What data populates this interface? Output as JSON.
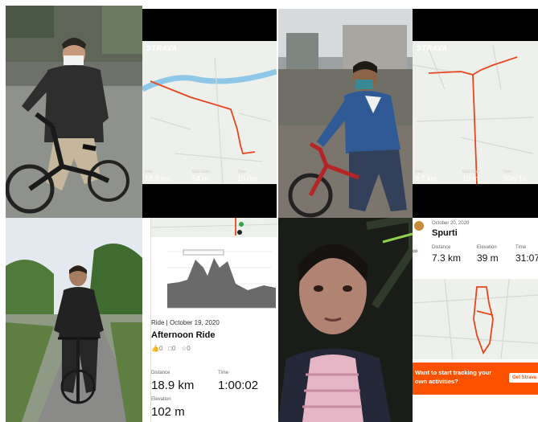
{
  "strava_card_1": {
    "logo": "STRAVA",
    "stats": [
      {
        "label": "Ride",
        "value": "18.8 km"
      },
      {
        "label": "Elev Gain",
        "value": "54 m"
      },
      {
        "label": "Time",
        "value": "1h 0m"
      }
    ]
  },
  "strava_card_2": {
    "logo": "STRAVA",
    "stats": [
      {
        "label": "Ride",
        "value": "9.7 km"
      },
      {
        "label": "Elev Gain",
        "value": "10 m"
      },
      {
        "label": "Time",
        "value": "30m 1s"
      }
    ]
  },
  "activity_card": {
    "ride_line": "Ride | October 19, 2020",
    "title": "Afternoon Ride",
    "kudos": "0",
    "comments": "0",
    "achievements": "0",
    "distance_label": "Distance",
    "distance_value": "18.9 km",
    "time_label": "Time",
    "time_value": "1:00:02",
    "elevation_label": "Elevation",
    "elevation_value": "102 m"
  },
  "spurti_card": {
    "date": "October 20, 2020",
    "name": "Spurti",
    "distance_label": "Distance",
    "distance_value": "7.3 km",
    "elevation_label": "Elevation",
    "elevation_value": "39 m",
    "time_label": "Time",
    "time_value": "31:07",
    "banner_text": "Want to start tracking your own activities?",
    "banner_button": "Get Strava"
  },
  "colors": {
    "strava_orange": "#fc5200",
    "route": "#e8461c"
  }
}
